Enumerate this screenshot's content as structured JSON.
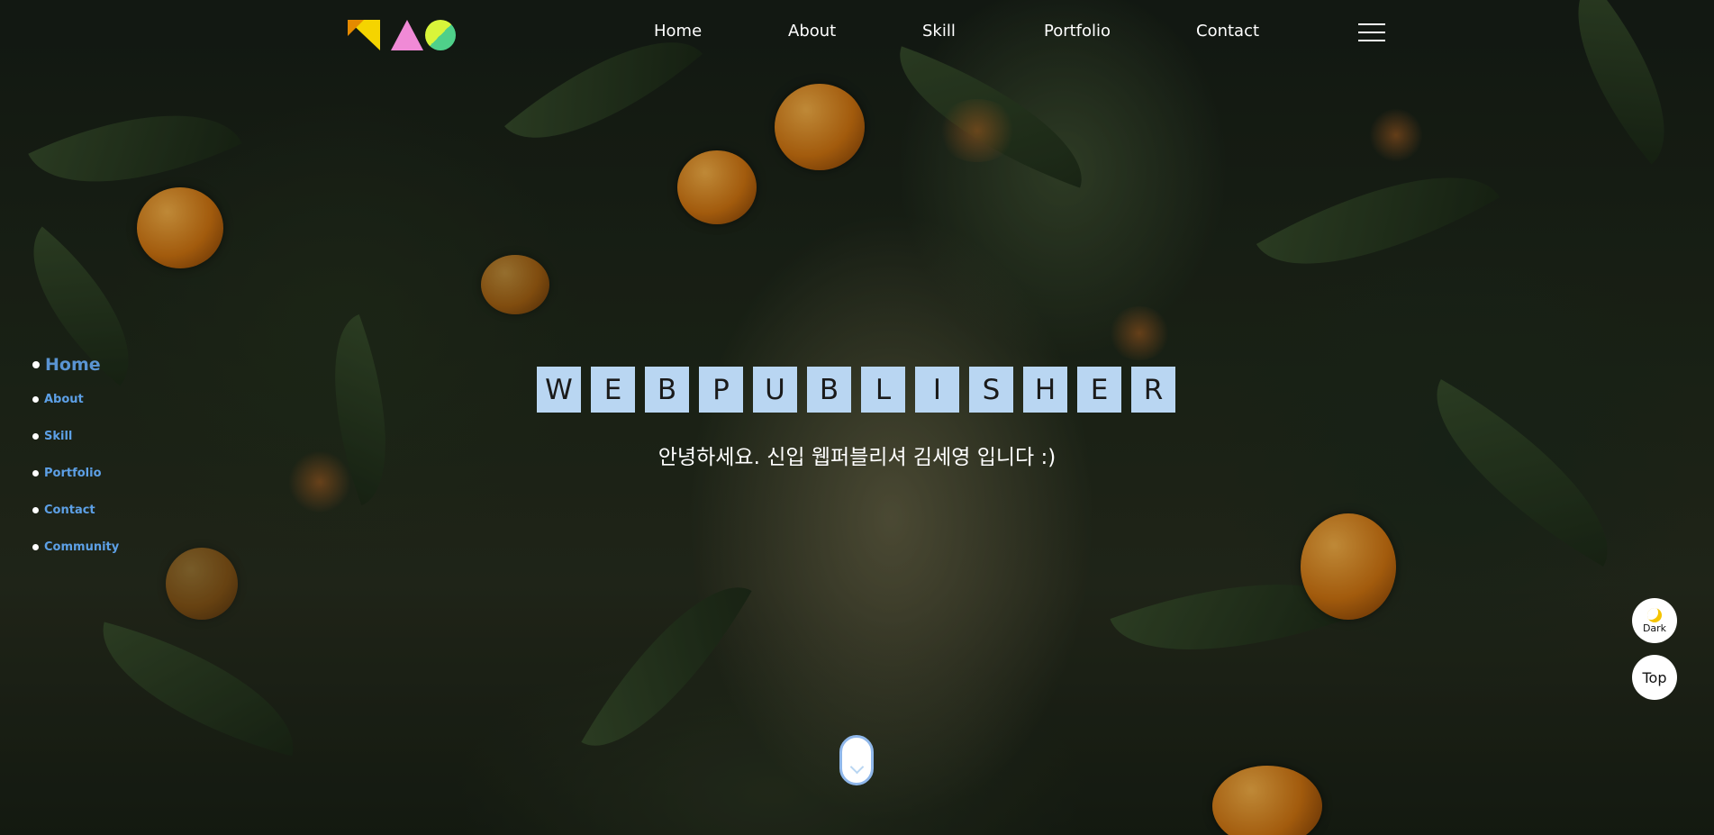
{
  "header": {
    "logo_name": "shapes-logo",
    "nav": [
      {
        "label": "Home"
      },
      {
        "label": "About"
      },
      {
        "label": "Skill"
      },
      {
        "label": "Portfolio"
      },
      {
        "label": "Contact"
      }
    ],
    "menu_icon": "hamburger-icon"
  },
  "side_nav": {
    "items": [
      {
        "label": "Home",
        "active": true
      },
      {
        "label": "About"
      },
      {
        "label": "Skill"
      },
      {
        "label": "Portfolio"
      },
      {
        "label": "Contact"
      },
      {
        "label": "Community"
      }
    ]
  },
  "hero": {
    "letters": [
      "W",
      "E",
      "B",
      "P",
      "U",
      "B",
      "L",
      "I",
      "S",
      "H",
      "E",
      "R"
    ],
    "subtitle": "안녕하세요. 신입 웹퍼블리셔 김세영 입니다 :)"
  },
  "scroll_button": {
    "icon": "chevron-down-icon"
  },
  "floating": {
    "dark": {
      "label": "Dark",
      "icon": "moon-icon"
    },
    "top": {
      "label": "Top"
    }
  },
  "colors": {
    "letter_bg": "#b9d6f2",
    "side_nav_text": "#5da0e6",
    "logo_yellow": "#f5d400",
    "logo_pink": "#f08ad6",
    "logo_green": "#4fd08a"
  }
}
